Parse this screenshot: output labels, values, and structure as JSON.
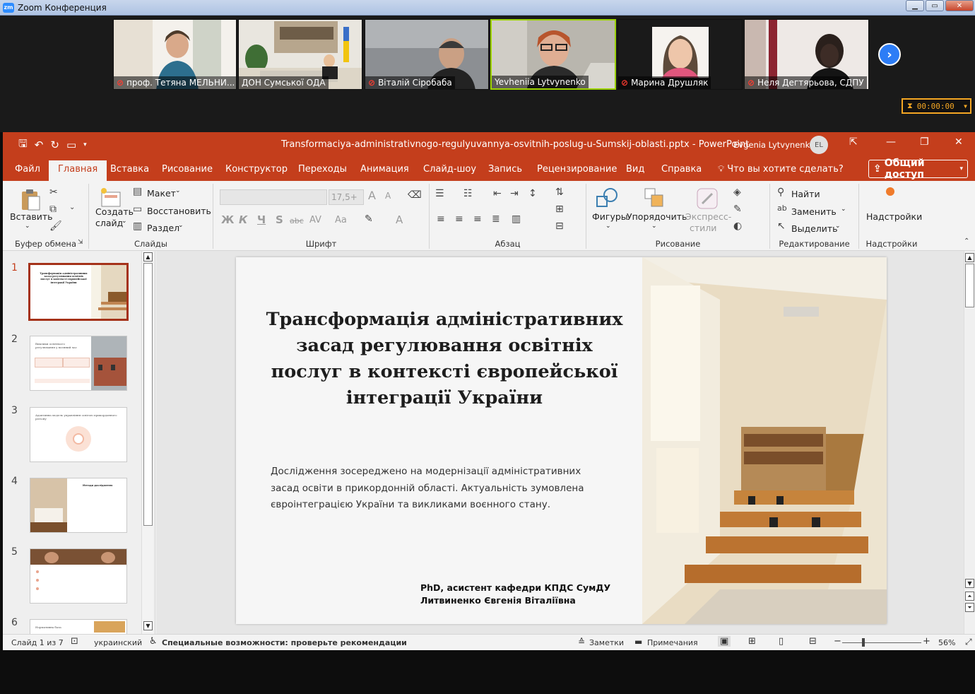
{
  "zoom": {
    "window_title": "Zoom Конференция",
    "win_buttons": [
      "▁",
      "▭",
      "✕"
    ],
    "participants": [
      {
        "name": "проф. Тетяна МЕЛЬНИ...",
        "muted": true
      },
      {
        "name": "ДОН Сумської ОДА",
        "muted": false
      },
      {
        "name": "Віталій Сіробаба",
        "muted": true
      },
      {
        "name": "Yevheniia Lytvynenko",
        "muted": false,
        "active": true
      },
      {
        "name": "Марина Друшляк",
        "muted": true
      },
      {
        "name": "Неля Дегтярьова, СДПУ",
        "muted": true
      }
    ],
    "timer": "00:00:00"
  },
  "ppt": {
    "doc_title": "Transformaciya-administrativnogo-regulyuvannya-osvitnih-poslug-u-Sumskij-oblasti.pptx  -  PowerPoint",
    "user_name": "Evgenia Lytvynenko",
    "user_initials": "EL",
    "tabs": [
      "Файл",
      "Главная",
      "Вставка",
      "Рисование",
      "Конструктор",
      "Переходы",
      "Анимация",
      "Слайд-шоу",
      "Запись",
      "Рецензирование",
      "Вид",
      "Справка"
    ],
    "search_hint": "Что вы хотите сделать?",
    "share": "Общий доступ",
    "ribbon": {
      "paste": "Вставить",
      "clipboard": "Буфер обмена",
      "new_slide_1": "Создать",
      "new_slide_2": "слайд",
      "layout": "Макет",
      "reset": "Восстановить",
      "section": "Раздел",
      "slides": "Слайды",
      "font_size": "17,5+",
      "bold": "Ж",
      "italic": "К",
      "underline": "Ч",
      "strike": "S",
      "strike_abc": "abc",
      "spacing": "AV",
      "case": "Aa",
      "font_grow": "A",
      "font_shrink": "A",
      "font_group": "Шрифт",
      "paragraph_group": "Абзац",
      "shapes": "Фигуры",
      "arrange": "Упорядочить",
      "quick_styles_1": "Экспресс-",
      "quick_styles_2": "стили",
      "drawing_group": "Рисование",
      "find": "Найти",
      "replace": "Заменить",
      "select": "Выделить",
      "editing_group": "Редактирование",
      "addins": "Надстройки",
      "addins_group": "Надстройки"
    },
    "slide_numbers": [
      "1",
      "2",
      "3",
      "4",
      "5",
      "6"
    ],
    "thumbs": [
      {
        "title": "Трансформація адміністративних засад регулювання освітніх послуг в контексті європейської інтеграції України"
      },
      {
        "title": "Виклики освітнього регулювання у воєнний час"
      },
      {
        "title": "Адаптивна модель управління освітою прикордонного регіону"
      },
      {
        "title": "Методи дослідження"
      },
      {
        "title": ""
      },
      {
        "title": "Нормативна база"
      }
    ],
    "slide": {
      "title": "Трансформація адміністративних засад регулювання освітніх послуг в контексті європейської інтеграції України",
      "body": "Дослідження зосереджено на модернізації адміністративних засад освіти в прикордонній області. Актуальність зумовлена євроінтеграцією України та викликами воєнного стану.",
      "author_line1": "PhD, асистент кафедри КПДС СумДУ",
      "author_line2": "Литвиненко Євгенія Віталіївна"
    },
    "status": {
      "slide_of": "Слайд 1 из 7",
      "language": "украинский",
      "accessibility": "Специальные возможности: проверьте рекомендации",
      "notes": "Заметки",
      "comments": "Примечания",
      "zoom": "56%"
    }
  },
  "colors": {
    "accent": "#c43e1c",
    "zoom_blue": "#2d8cff",
    "timer": "#f5a623",
    "active_speaker": "#9dd400"
  }
}
